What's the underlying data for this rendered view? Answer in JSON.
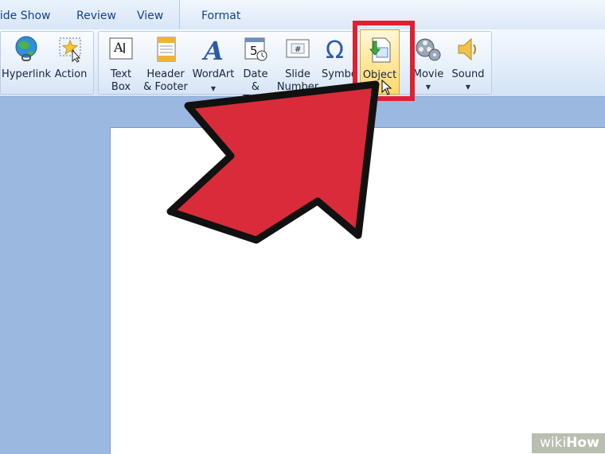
{
  "ribbon_tabs": [
    "lide Show",
    "Review",
    "View",
    "Format"
  ],
  "buttons": {
    "hyperlink": "Hyperlink",
    "action": "Action",
    "text_box": "Text\nBox",
    "header_footer": "Header\n& Footer",
    "wordart": "WordArt",
    "date_time": "Date\n& Time",
    "slide_number": "Slide\nNumber",
    "symbol": "Symbol",
    "object": "Object",
    "movie": "Movie",
    "sound": "Sound"
  },
  "icons": {
    "date_day": "5",
    "slide_number_mark": "#",
    "text_box_mark": "A",
    "symbol_mark": "Ω"
  },
  "watermark": {
    "prefix": "wiki",
    "suffix": "How"
  },
  "colors": {
    "highlight": "#e02030",
    "arrow": "#d92b3a",
    "ribbon_text": "#15428b"
  }
}
